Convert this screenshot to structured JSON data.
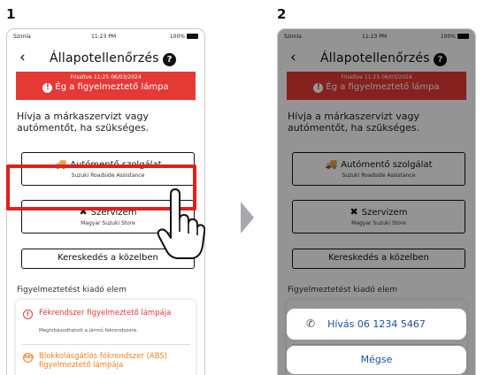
{
  "steps": [
    "1",
    "2"
  ],
  "statusbar": {
    "carrier": "Szimla",
    "time": "11:23 PM",
    "battery": "100%"
  },
  "nav": {
    "title": "Állapotellenőrzés",
    "help": "?"
  },
  "alert": {
    "updated": "Frissítve 11:25 06/03/2024",
    "message": "Ég a figyelmeztető lámpa",
    "icon": "!"
  },
  "instruction": "Hívja a márkaszervizt vagy autómentőt, ha szükséges.",
  "buttons": {
    "tow": {
      "label": "Autómentő szolgálat",
      "sub": "Suzuki Roadside Assistance",
      "icon": "tow-truck-icon"
    },
    "service": {
      "label": "Szervizem",
      "sub": "Magyar Suzuki Store",
      "icon": "tools-icon"
    },
    "dealer": {
      "label": "Kereskedés a közelben"
    }
  },
  "section_label": "Figyelmeztetést kiadó elem",
  "warnings": [
    {
      "title": "Fékrendszer figyelmeztető lámpája",
      "desc": "Meghibásodhatott a jármű fékrendszere.",
      "icon": "!"
    },
    {
      "title": "Blokkolásgátlós fékrendszer (ABS) figyelmeztető lámpája",
      "desc": "",
      "icon": "ABS"
    }
  ],
  "sheet": {
    "call": "Hívás 06 1234 5467",
    "cancel": "Mégse"
  },
  "colors": {
    "alert_red": "#e53935",
    "highlight_red": "#e0201a",
    "link_blue": "#1a4fa3",
    "abs_orange": "#f58220",
    "arrow_gray": "#a6a8ac"
  }
}
